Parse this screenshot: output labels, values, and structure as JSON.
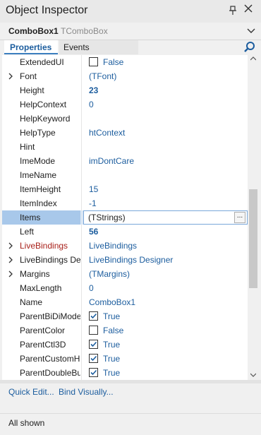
{
  "window": {
    "title": "Object Inspector"
  },
  "selector": {
    "component": "ComboBox1",
    "type": "TComboBox"
  },
  "tabs": {
    "properties": "Properties",
    "events": "Events"
  },
  "rows": [
    {
      "name": "ExtendedUI",
      "kind": "check",
      "checked": false,
      "value": "False"
    },
    {
      "name": "Font",
      "kind": "text",
      "value": "(TFont)",
      "expand": true
    },
    {
      "name": "Height",
      "kind": "bold",
      "value": "23"
    },
    {
      "name": "HelpContext",
      "kind": "text",
      "value": "0"
    },
    {
      "name": "HelpKeyword",
      "kind": "text",
      "value": ""
    },
    {
      "name": "HelpType",
      "kind": "text",
      "value": "htContext"
    },
    {
      "name": "Hint",
      "kind": "text",
      "value": ""
    },
    {
      "name": "ImeMode",
      "kind": "text",
      "value": "imDontCare"
    },
    {
      "name": "ImeName",
      "kind": "text",
      "value": ""
    },
    {
      "name": "ItemHeight",
      "kind": "text",
      "value": "15"
    },
    {
      "name": "ItemIndex",
      "kind": "text",
      "value": "-1"
    },
    {
      "name": "Items",
      "kind": "selected",
      "value": "(TStrings)",
      "button": "..."
    },
    {
      "name": "Left",
      "kind": "bold",
      "value": "56"
    },
    {
      "name": "LiveBindings",
      "kind": "text",
      "value": "LiveBindings",
      "expand": true,
      "red": true
    },
    {
      "name": "LiveBindings Designer",
      "kind": "text",
      "value": "LiveBindings Designer",
      "expand": true
    },
    {
      "name": "Margins",
      "kind": "text",
      "value": "(TMargins)",
      "expand": true
    },
    {
      "name": "MaxLength",
      "kind": "text",
      "value": "0"
    },
    {
      "name": "Name",
      "kind": "text",
      "value": "ComboBox1"
    },
    {
      "name": "ParentBiDiMode",
      "kind": "check",
      "checked": true,
      "value": "True"
    },
    {
      "name": "ParentColor",
      "kind": "check",
      "checked": false,
      "value": "False"
    },
    {
      "name": "ParentCtl3D",
      "kind": "check",
      "checked": true,
      "value": "True"
    },
    {
      "name": "ParentCustomHint",
      "kind": "check",
      "checked": true,
      "value": "True"
    },
    {
      "name": "ParentDoubleBuffered",
      "kind": "check",
      "checked": true,
      "value": "True"
    }
  ],
  "links": {
    "quick_edit": "Quick Edit...",
    "bind_visually": "Bind Visually..."
  },
  "status": {
    "text": "All shown"
  },
  "colors": {
    "accent": "#1c5d9e",
    "selected_row": "#a8c8ea",
    "red_property": "#a8201a"
  }
}
